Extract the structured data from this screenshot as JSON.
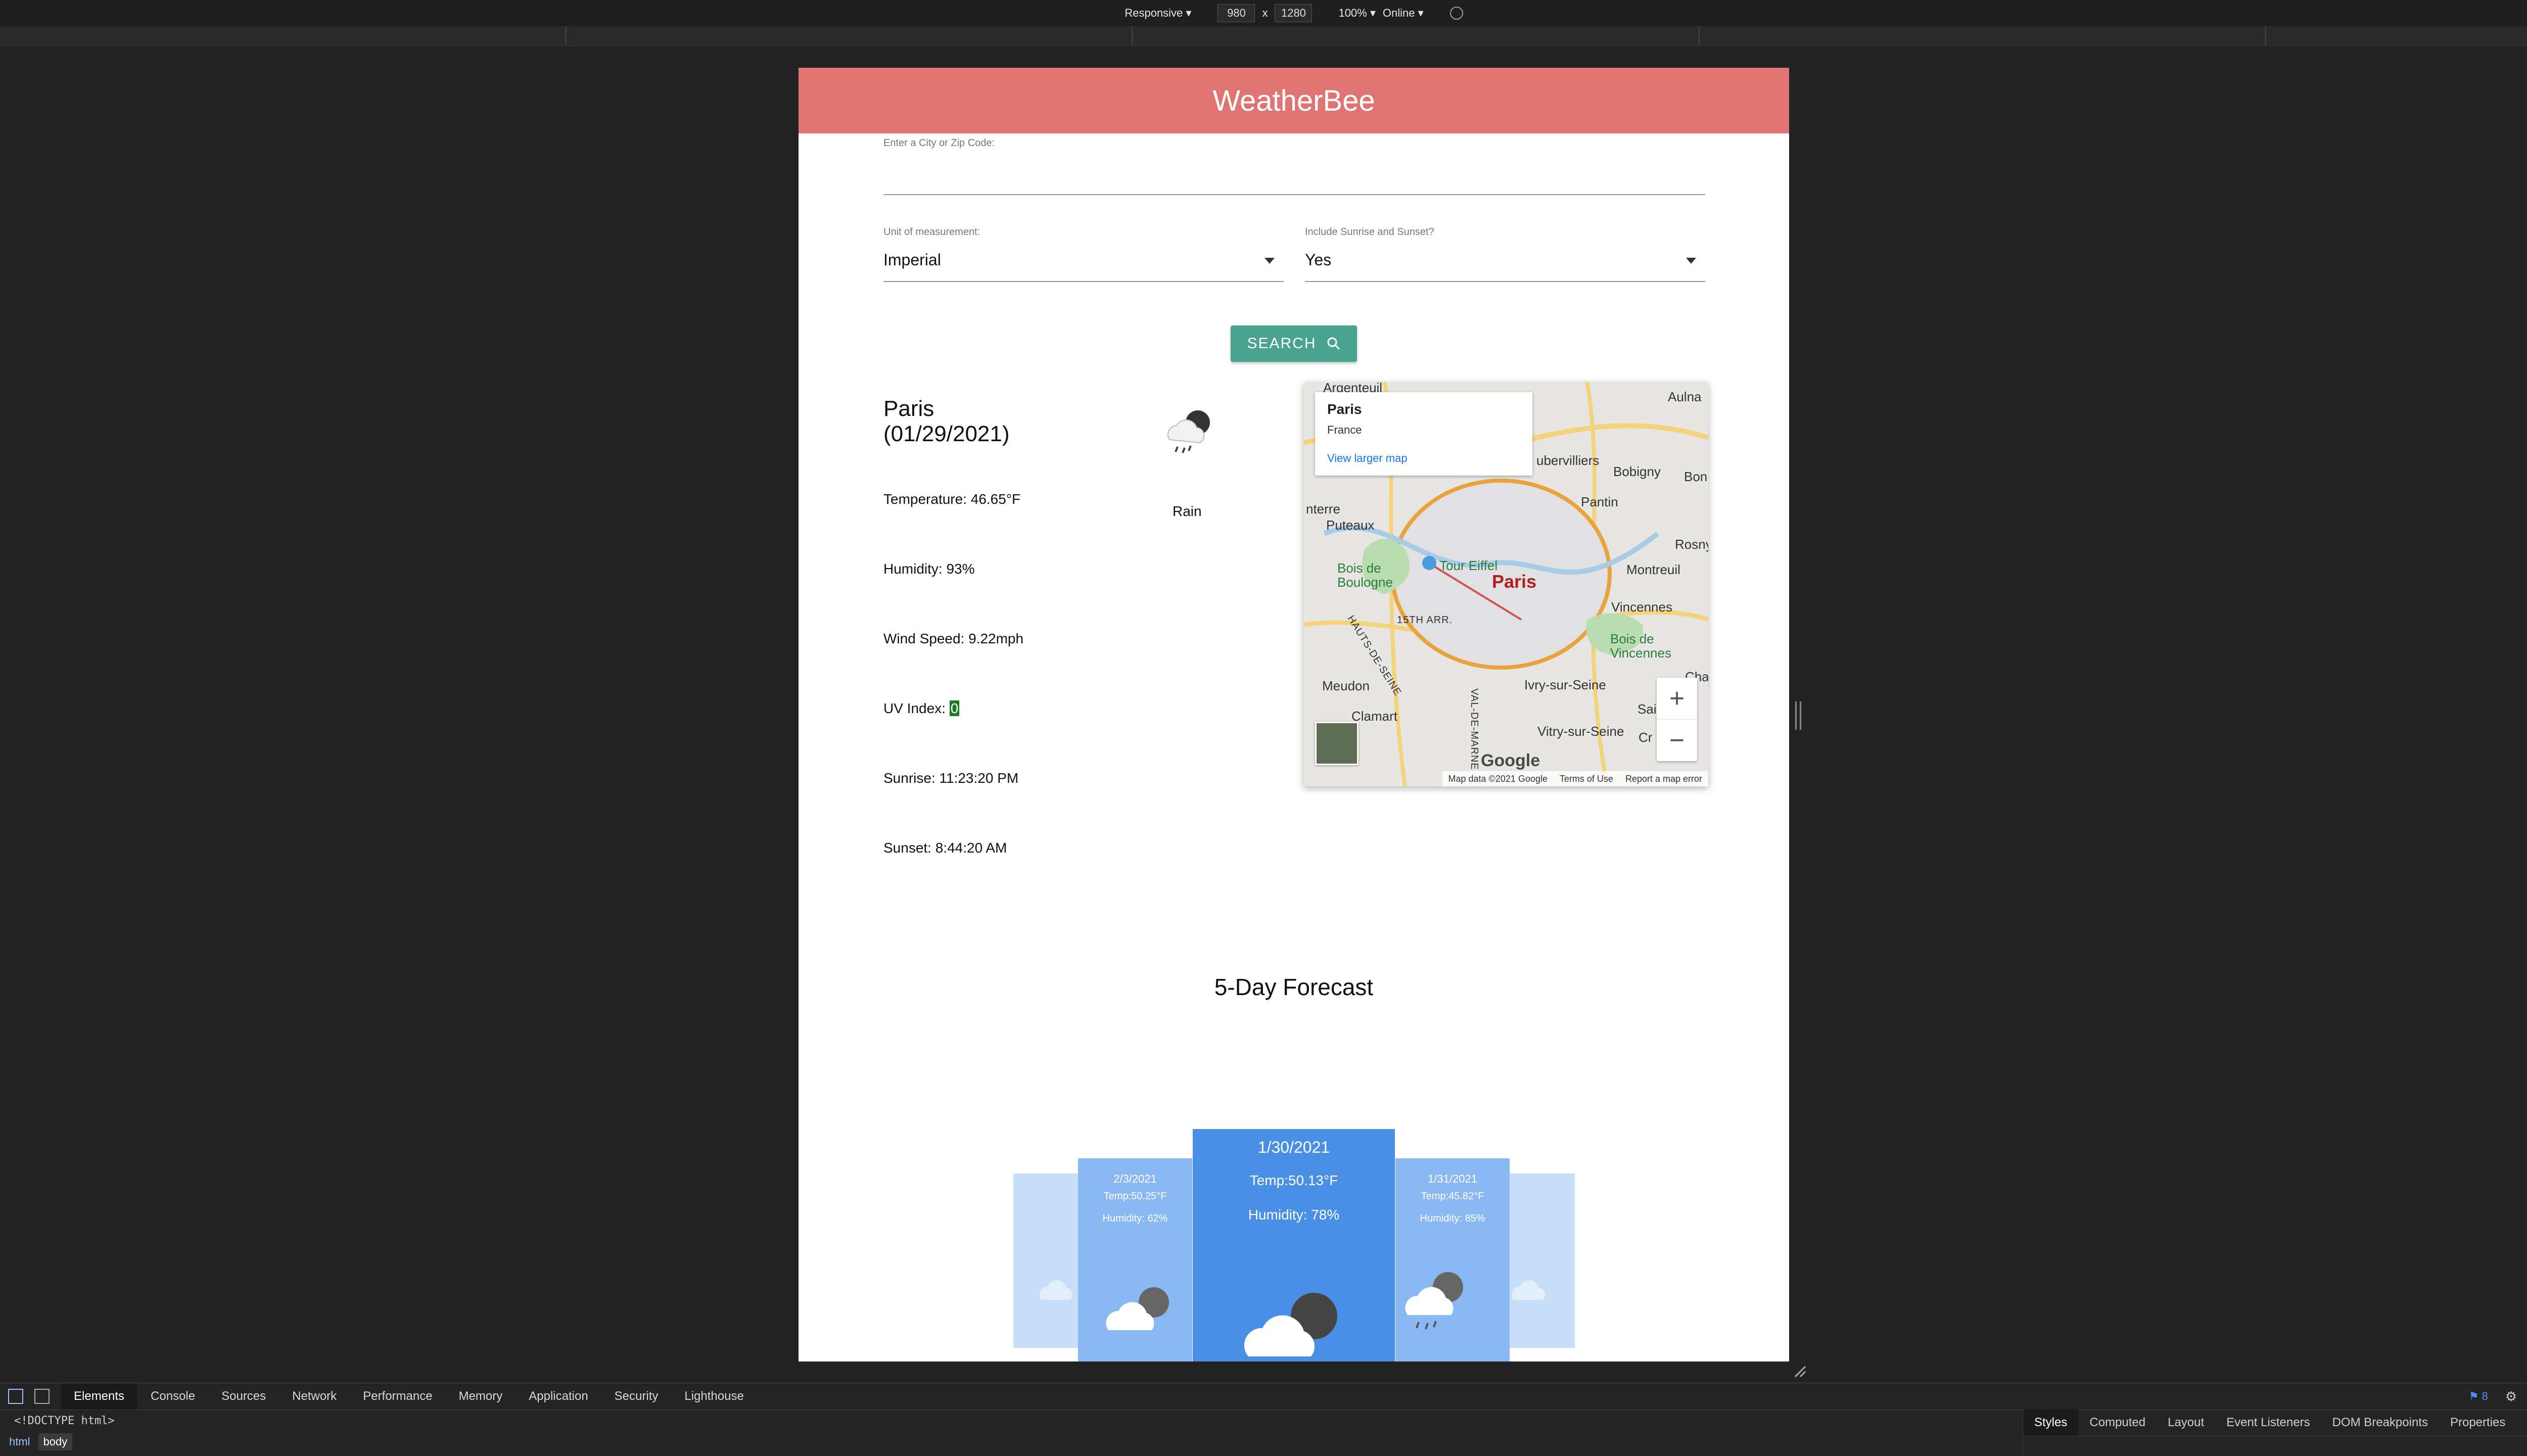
{
  "devtools_toolbar": {
    "device": "Responsive ▾",
    "width": "980",
    "times": "x",
    "height": "1280",
    "zoom": "100% ▾",
    "throttle": "Online ▾"
  },
  "app": {
    "title": "WeatherBee",
    "search_label": "Enter a City or Zip Code:",
    "search_value": "",
    "unit_label": "Unit of measurement:",
    "unit_value": "Imperial",
    "sun_label": "Include Sunrise and Sunset?",
    "sun_value": "Yes",
    "search_button": "SEARCH"
  },
  "current": {
    "city": "Paris",
    "date": "(01/29/2021)",
    "condition": "Rain",
    "temperature": "Temperature: 46.65°F",
    "humidity": "Humidity: 93%",
    "wind": "Wind Speed: 9.22mph",
    "uv_label": "UV Index:",
    "uv_value": "0",
    "sunrise": "Sunrise: 11:23:20 PM",
    "sunset": "Sunset: 8:44:20 AM"
  },
  "map": {
    "card_title": "Paris",
    "card_subtitle": "France",
    "card_link": "View larger map",
    "labels": {
      "argenteuil": "Argenteuil",
      "aulna": "Aulna",
      "aubervilliers": "ubervilliers",
      "bobigny": "Bobigny",
      "bon": "Bon",
      "pantin": "Pantin",
      "nterre": "nterre",
      "puteaux": "Puteaux",
      "rosny": "Rosny-s",
      "montreuil": "Montreuil",
      "tour_eiffel": "Tour Eiffel",
      "paris": "Paris",
      "bois_boulogne": "Bois de\nBoulogne",
      "arr": "15TH ARR.",
      "vincennes": "Vincennes",
      "bois_vincennes": "Bois de\nVincennes",
      "meudon": "Meudon",
      "ivry": "Ivry-sur-Seine",
      "cha": "Cha",
      "clamart": "Clamart",
      "sai": "Sai",
      "vitry": "Vitry-sur-Seine",
      "cr": "Cr",
      "hauts_de_seine": "HAUTS-DE-SEINE",
      "val_de_marne": "VAL-DE-MARNE"
    },
    "google": "Google",
    "attribution": "Map data ©2021 Google",
    "terms": "Terms of Use",
    "report": "Report a map error"
  },
  "forecast": {
    "title": "5-Day Forecast",
    "cards": [
      {
        "date": "1/30/2021",
        "temp": "Temp:50.13°F",
        "humidity": "Humidity: 78%"
      },
      {
        "date": "2/3/2021",
        "temp": "Temp:50.25°F",
        "humidity": "Humidity: 62%"
      },
      {
        "date": "1/31/2021",
        "temp": "Temp:45.82°F",
        "humidity": "Humidity: 85%"
      }
    ]
  },
  "devtools": {
    "tabs": [
      "Elements",
      "Console",
      "Sources",
      "Network",
      "Performance",
      "Memory",
      "Application",
      "Security",
      "Lighthouse"
    ],
    "issues_count": "8",
    "doctype": "<!DOCTYPE html>",
    "breadcrumbs": [
      "html",
      "body"
    ],
    "styles_tabs": [
      "Styles",
      "Computed",
      "Layout",
      "Event Listeners",
      "DOM Breakpoints",
      "Properties"
    ]
  },
  "colors": {
    "header": "#df7473",
    "button": "#4aa38e",
    "forecast_card": "#4a8fe6",
    "uv_highlight": "#1d7c1f"
  }
}
